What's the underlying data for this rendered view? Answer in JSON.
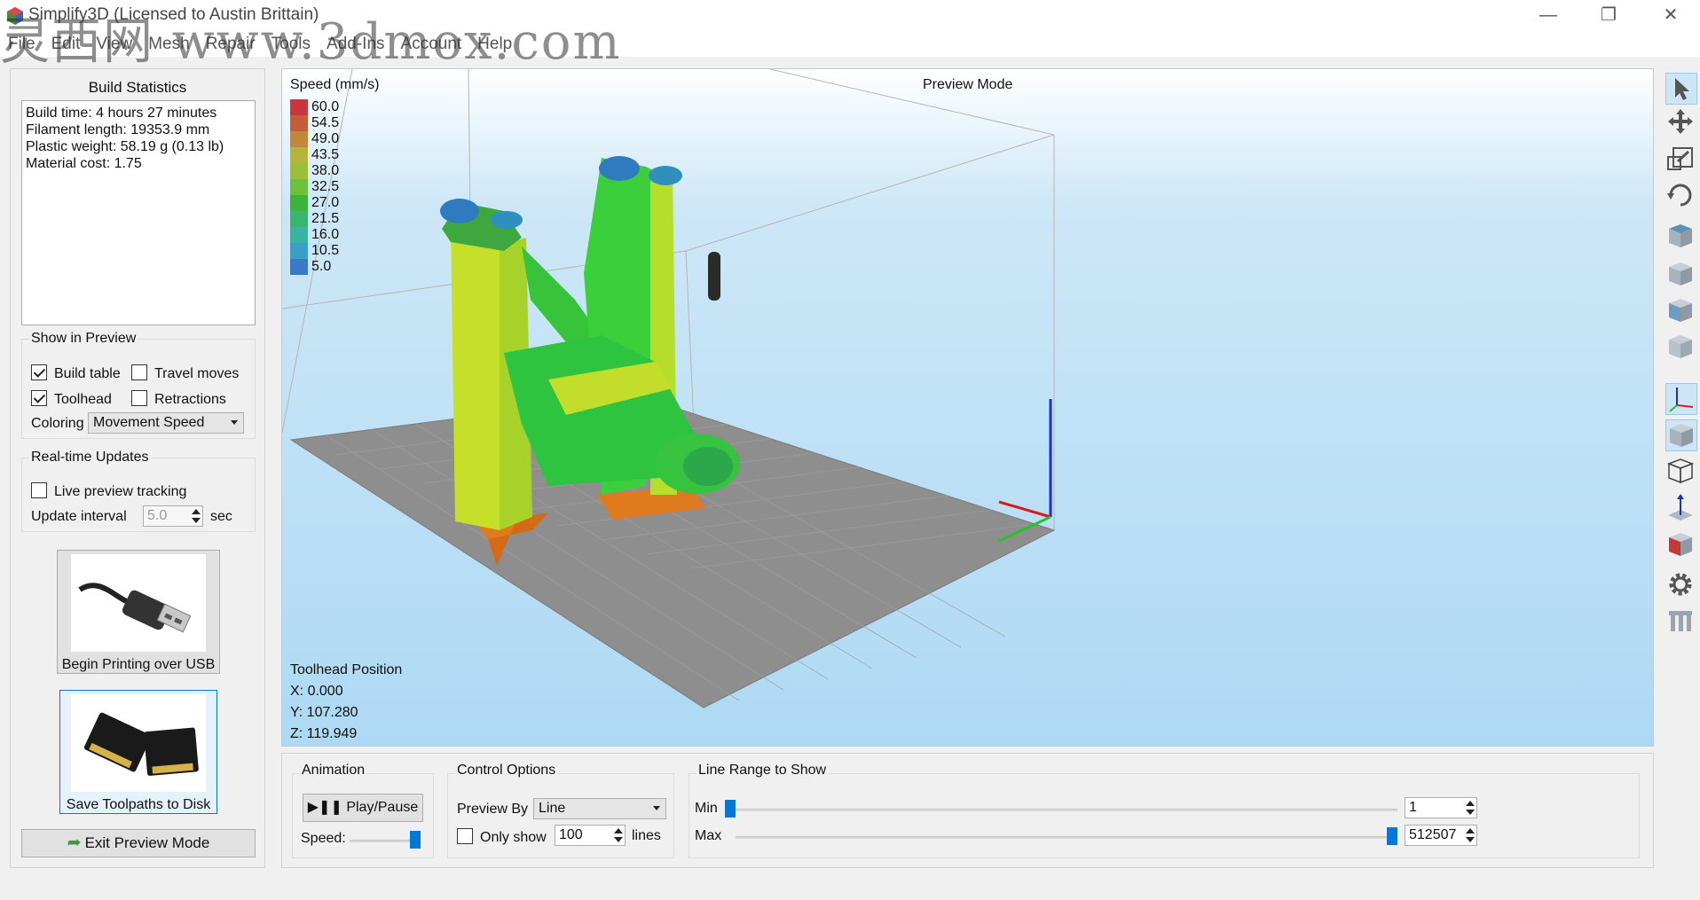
{
  "window": {
    "title": "Simplify3D (Licensed to Austin Brittain)",
    "watermark": "灵西网 www.3dmox.com",
    "controls": {
      "minimize": "—",
      "restore": "❐",
      "close": "✕"
    }
  },
  "menu": [
    "File",
    "Edit",
    "View",
    "Mesh",
    "Repair",
    "Tools",
    "Add-Ins",
    "Account",
    "Help"
  ],
  "build_stats": {
    "title": "Build Statistics",
    "lines": [
      "Build time: 4 hours 27 minutes",
      "Filament length: 19353.9 mm",
      "Plastic weight: 58.19 g (0.13 lb)",
      "Material cost: 1.75"
    ]
  },
  "show_in_preview": {
    "title": "Show in Preview",
    "build_table": {
      "label": "Build table",
      "checked": true
    },
    "travel_moves": {
      "label": "Travel moves",
      "checked": false
    },
    "toolhead": {
      "label": "Toolhead",
      "checked": true
    },
    "retractions": {
      "label": "Retractions",
      "checked": false
    },
    "coloring_label": "Coloring",
    "coloring_value": "Movement Speed"
  },
  "realtime": {
    "title": "Real-time Updates",
    "live_tracking": {
      "label": "Live preview tracking",
      "checked": false
    },
    "interval_label": "Update interval",
    "interval_value": "5.0",
    "interval_unit": "sec"
  },
  "usb_button": {
    "label": "Begin Printing over USB",
    "icon": "usb-cable-icon"
  },
  "sd_button": {
    "label": "Save Toolpaths to Disk",
    "icon": "sd-card-icon"
  },
  "exit_button": {
    "label": "Exit Preview Mode",
    "icon": "back-arrow-icon"
  },
  "viewport": {
    "mode_label": "Preview Mode",
    "legend_title": "Speed (mm/s)",
    "legend": [
      {
        "value": "60.0",
        "color": "#c8373c"
      },
      {
        "value": "54.5",
        "color": "#c45e3a"
      },
      {
        "value": "49.0",
        "color": "#c2873a"
      },
      {
        "value": "43.5",
        "color": "#b4b43a"
      },
      {
        "value": "38.0",
        "color": "#9cbf3a"
      },
      {
        "value": "32.5",
        "color": "#6cc03a"
      },
      {
        "value": "27.0",
        "color": "#3cb43c"
      },
      {
        "value": "21.5",
        "color": "#3ab46e"
      },
      {
        "value": "16.0",
        "color": "#3ab4a0"
      },
      {
        "value": "10.5",
        "color": "#3aa0c8"
      },
      {
        "value": "5.0",
        "color": "#3a78c8"
      }
    ],
    "toolhead_title": "Toolhead Position",
    "toolhead_x": "X: 0.000",
    "toolhead_y": "Y: 107.280",
    "toolhead_z": "Z: 119.949"
  },
  "toolbar_icons": [
    "select-icon",
    "move-icon",
    "scale-icon",
    "rotate-icon",
    "view-top-icon",
    "view-front-icon",
    "view-side-icon",
    "view-iso-icon",
    "axes-icon",
    "solid-view-icon",
    "wireframe-view-icon",
    "normals-icon",
    "cross-section-icon",
    "settings-gear-icon",
    "support-icon"
  ],
  "animation": {
    "title": "Animation",
    "play_label": "Play/Pause",
    "speed_label": "Speed:",
    "speed_level": 1.0
  },
  "control_options": {
    "title": "Control Options",
    "preview_by_label": "Preview By",
    "preview_by_value": "Line",
    "only_show_label": "Only show",
    "only_show_checked": false,
    "only_show_value": "100",
    "only_show_unit": "lines"
  },
  "line_range": {
    "title": "Line Range to Show",
    "min_label": "Min",
    "min_value": "1",
    "max_label": "Max",
    "max_value": "512507",
    "min_fraction": 0.0,
    "max_fraction": 1.0
  }
}
